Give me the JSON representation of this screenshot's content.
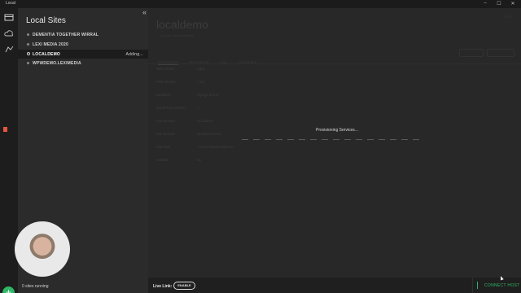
{
  "window": {
    "title": "Local",
    "controls": [
      "–",
      "☐",
      "✕"
    ]
  },
  "rail": {
    "icons": [
      "sites-icon",
      "cloud-icon",
      "addons-icon",
      "notice-icon"
    ],
    "accent": "#e5553f"
  },
  "sites_panel": {
    "title": "Local Sites",
    "collapse": "«",
    "items": [
      {
        "name": "DEMENTIA TOGETHER WIRRAL",
        "status": "",
        "active": false
      },
      {
        "name": "LEXI MEDIA 2020",
        "status": "",
        "active": false
      },
      {
        "name": "LOCALDEMO",
        "status": "Adding...",
        "active": true
      },
      {
        "name": "WPWDEMO.LEXIMEDIA",
        "status": "",
        "active": false
      }
    ],
    "add_button": "+",
    "running_text": "0 sites running"
  },
  "main": {
    "site_name": "localdemo",
    "subtitle": "~/Local Sites/localdemo",
    "top_right": "SITE",
    "tabs": [
      {
        "label": "OVERVIEW",
        "selected": true
      },
      {
        "label": "DATABASE",
        "selected": false
      },
      {
        "label": "SSL",
        "selected": false
      },
      {
        "label": "UTILITIES",
        "selected": false
      }
    ],
    "fields": [
      {
        "label": "Web Server",
        "value": "nginx"
      },
      {
        "label": "PHP Version",
        "value": "7.3.5"
      },
      {
        "label": "Database",
        "value": "MySQL 8.0.16"
      },
      {
        "label": "WordPress Version",
        "value": "—"
      },
      {
        "label": "Site Domain",
        "value": "localdemo"
      },
      {
        "label": "Site Domain",
        "value": "localdemo.local"
      },
      {
        "label": "Site Path",
        "value": "~/Local Sites/localdemo"
      },
      {
        "label": "Multisite",
        "value": "No"
      }
    ],
    "provisioning_text": "Provisioning Services..."
  },
  "footer": {
    "live_link_label": "Live Link:",
    "enable_button": "ENABLE",
    "connect_host": "CONNECT HOST"
  },
  "colors": {
    "green": "#2fb766",
    "bg": "#262626",
    "panel": "#2b2b2b"
  }
}
